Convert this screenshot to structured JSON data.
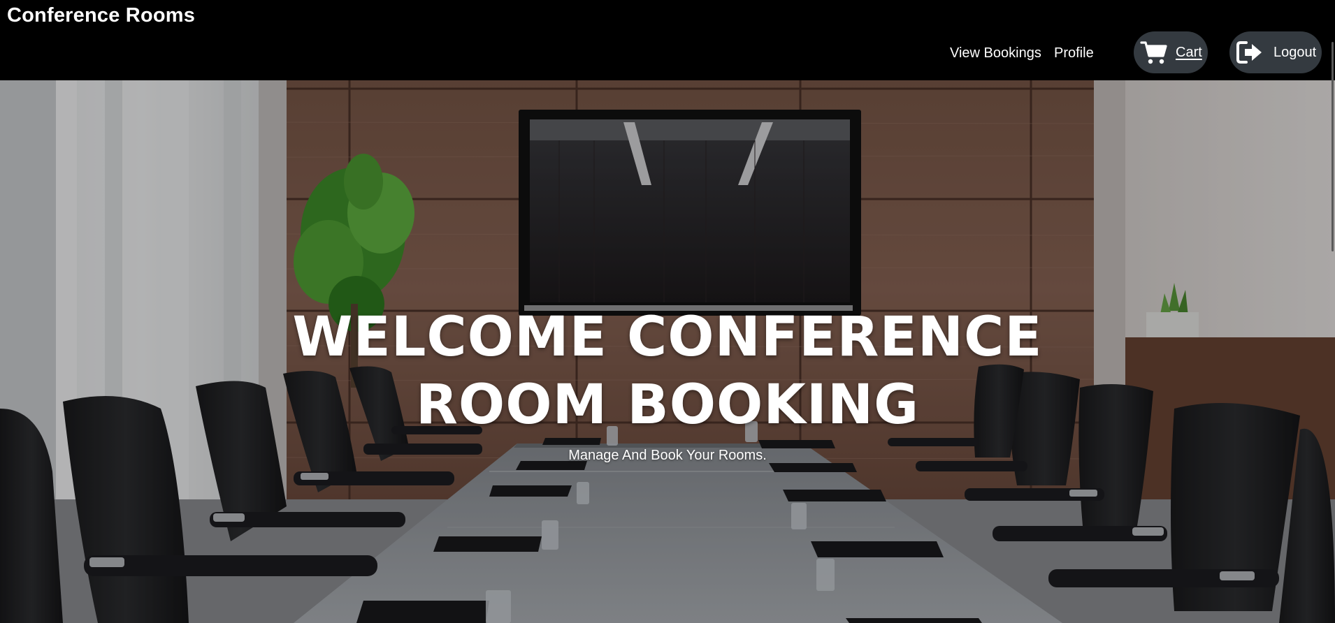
{
  "app": {
    "title": "Conference Rooms"
  },
  "nav": {
    "view_bookings": "View Bookings",
    "profile": "Profile",
    "cart": "Cart",
    "logout": "Logout"
  },
  "icons": {
    "cart": "shopping-cart-icon",
    "logout": "sign-out-icon"
  },
  "hero": {
    "title_line1": "WELCOME CONFERENCE",
    "title_line2": "ROOM BOOKING",
    "subtitle": "Manage And Book Your Rooms."
  },
  "colors": {
    "header_bg": "#000000",
    "pill_bg": "#343a40",
    "text": "#ffffff"
  }
}
